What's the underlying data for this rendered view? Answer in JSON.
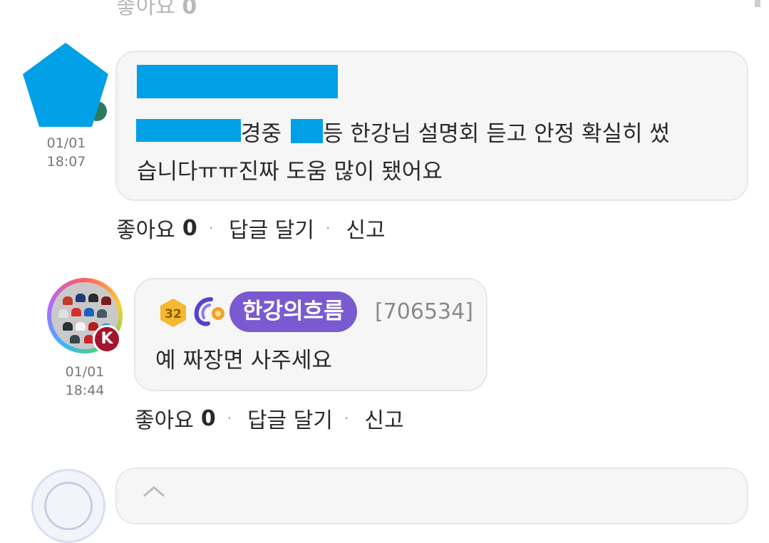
{
  "prev_actions": {
    "like_label": "좋아요",
    "like_count": "0"
  },
  "comments": [
    {
      "time_date": "01/01",
      "time_clock": "18:07",
      "text_line1_a": "경중",
      "text_line1_b": "등 한강님 설명회 듣고 안정 확실히 썼",
      "text_line2": "습니다ㅠㅠ진짜 도움 많이 됐어요",
      "actions": {
        "like_label": "좋아요",
        "like_count": "0",
        "reply_label": "답글 달기",
        "report_label": "신고"
      }
    },
    {
      "level": "32",
      "author": "한강의흐름",
      "user_id": "[706534]",
      "avatar_badge": "K",
      "time_date": "01/01",
      "time_clock": "18:44",
      "text": "예 짜장면 사주세요",
      "actions": {
        "like_label": "좋아요",
        "like_count": "0",
        "reply_label": "답글 달기",
        "report_label": "신고"
      }
    }
  ],
  "colors": {
    "redaction": "#00a0e6",
    "name_pill": "#7a5ad0",
    "level_badge": "#f5b82e",
    "avatar_badge": "#a3152c"
  },
  "icons": [
    "pentagon-avatar-icon",
    "level-badge-icon",
    "emblem-icon",
    "more-dot-icon"
  ]
}
